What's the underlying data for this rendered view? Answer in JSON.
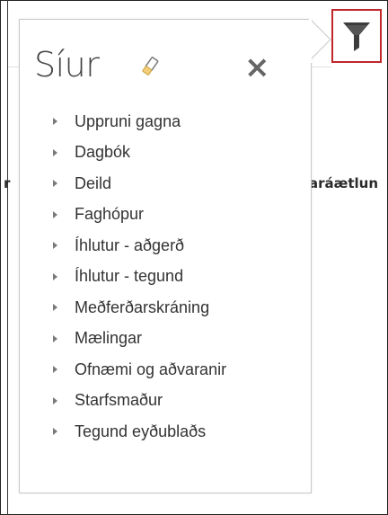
{
  "filter_panel": {
    "title": "Síur",
    "items": [
      {
        "label": "Uppruni gagna"
      },
      {
        "label": "Dagbók"
      },
      {
        "label": "Deild"
      },
      {
        "label": "Faghópur"
      },
      {
        "label": "Íhlutur - aðgerð"
      },
      {
        "label": "Íhlutur - tegund"
      },
      {
        "label": "Meðferðarskráning"
      },
      {
        "label": "Mælingar"
      },
      {
        "label": "Ofnæmi og aðvaranir"
      },
      {
        "label": "Starfsmaður"
      },
      {
        "label": "Tegund eyðublaðs"
      }
    ]
  },
  "background": {
    "left_text": "r",
    "right_text": "aráætlun"
  },
  "icons": {
    "filter_button": "funnel-icon",
    "clear": "eraser-icon",
    "close": "close-icon"
  },
  "colors": {
    "filter_button_border": "#c0272d",
    "funnel": "#3c3c3c"
  }
}
